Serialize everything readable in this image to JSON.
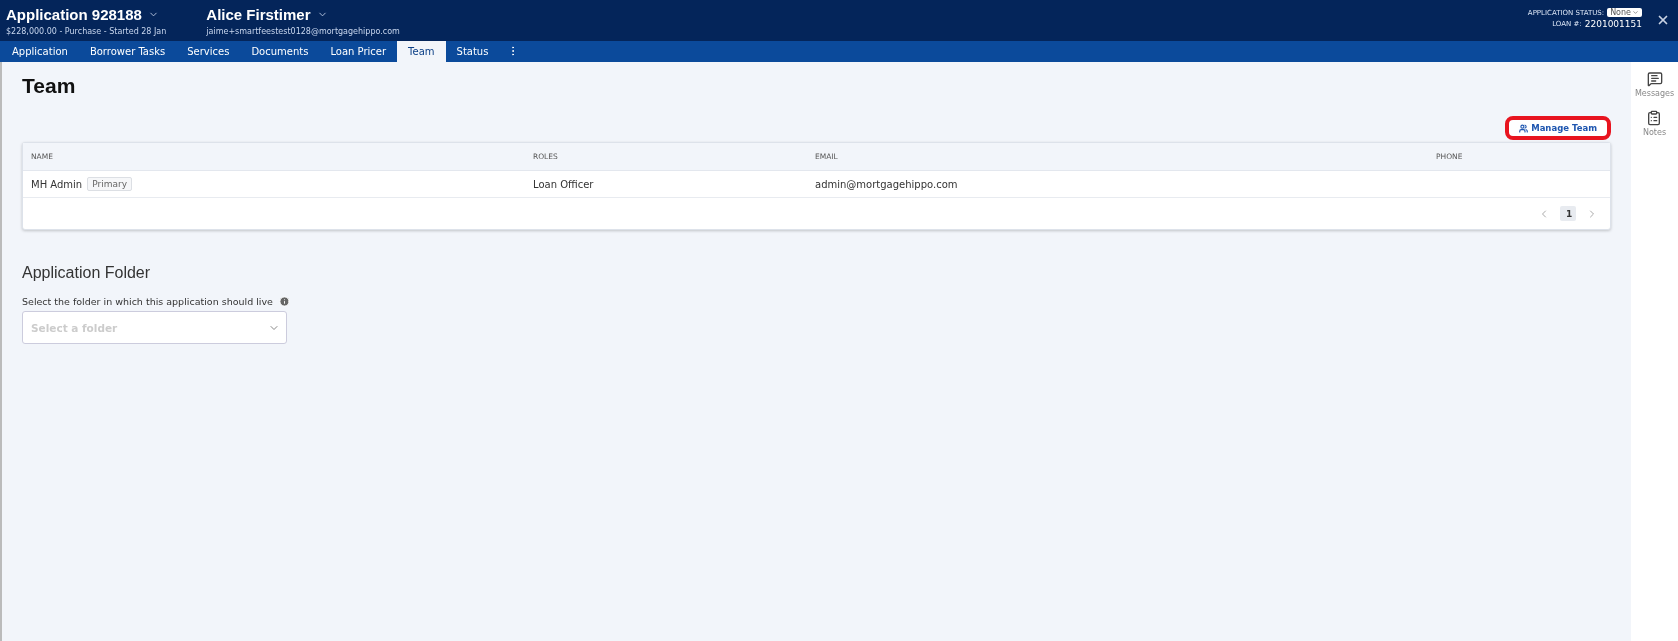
{
  "header": {
    "application": {
      "title": "Application 928188",
      "subtitle": "$228,000.00 - Purchase - Started 28 Jan"
    },
    "borrower": {
      "name": "Alice Firstimer",
      "email": "jaime+smartfeestest0128@mortgagehippo.com"
    },
    "status_label": "APPLICATION STATUS:",
    "status_value": "None",
    "loan_label": "LOAN #:",
    "loan_number": "2201001151"
  },
  "tabs": [
    {
      "label": "Application",
      "selected": false
    },
    {
      "label": "Borrower Tasks",
      "selected": false
    },
    {
      "label": "Services",
      "selected": false
    },
    {
      "label": "Documents",
      "selected": false
    },
    {
      "label": "Loan Pricer",
      "selected": false
    },
    {
      "label": "Team",
      "selected": true
    },
    {
      "label": "Status",
      "selected": false
    }
  ],
  "page_title": "Team",
  "manage_button": {
    "label": "Manage Team",
    "highlighted": true
  },
  "table": {
    "columns": [
      "NAME",
      "ROLES",
      "EMAIL",
      "PHONE"
    ],
    "rows": [
      {
        "name": "MH Admin",
        "badge": "Primary",
        "role": "Loan Officer",
        "email": "admin@mortgagehippo.com"
      }
    ],
    "page": "1"
  },
  "folder": {
    "title": "Application Folder",
    "label": "Select the folder in which this application should live",
    "placeholder": "Select a folder"
  },
  "sidebar": [
    {
      "label": "Messages",
      "kind": "messages"
    },
    {
      "label": "Notes",
      "kind": "notes"
    }
  ]
}
